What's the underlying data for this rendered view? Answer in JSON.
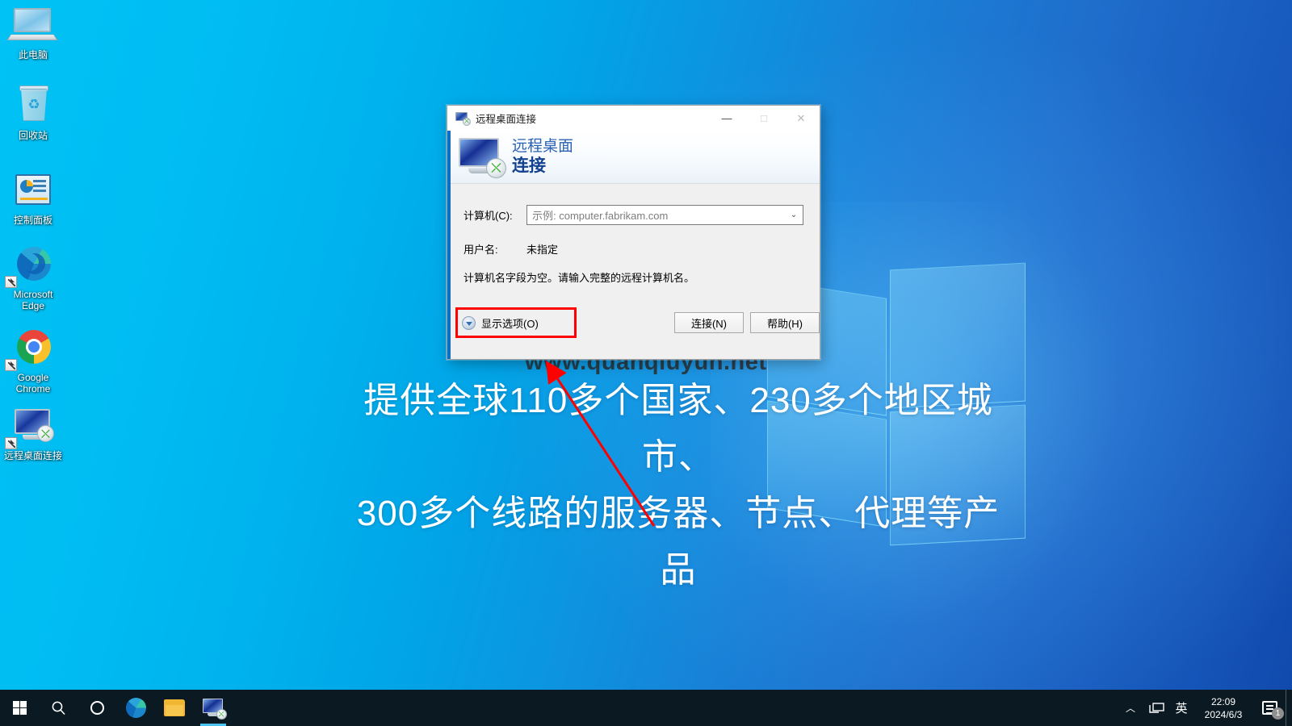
{
  "desktop": {
    "icons": [
      {
        "name": "this-pc",
        "label": "此电脑",
        "icon": "monitor-icon",
        "shortcut": false
      },
      {
        "name": "recycle-bin",
        "label": "回收站",
        "icon": "recycle-bin-icon",
        "shortcut": false
      },
      {
        "name": "control-panel",
        "label": "控制面板",
        "icon": "control-panel-icon",
        "shortcut": false
      },
      {
        "name": "microsoft-edge",
        "label": "Microsoft\nEdge",
        "icon": "edge-icon",
        "shortcut": true
      },
      {
        "name": "google-chrome",
        "label": "Google\nChrome",
        "icon": "chrome-icon",
        "shortcut": true
      },
      {
        "name": "remote-desktop-connection",
        "label": "远程桌面连接",
        "icon": "rdp-icon",
        "shortcut": true
      }
    ],
    "watermark_url": "www.quanqiuyun.net",
    "promo_line1": "提供全球110多个国家、230多个地区城市、",
    "promo_line2": "300多个线路的服务器、节点、代理等产品"
  },
  "dialog": {
    "titlebar": {
      "title": "远程桌面连接",
      "minimize": "—",
      "maximize": "□",
      "close": "✕"
    },
    "header": {
      "line1": "远程桌面",
      "line2": "连接"
    },
    "form": {
      "computer_label": "计算机(C):",
      "computer_placeholder": "示例: computer.fabrikam.com",
      "computer_value": "",
      "username_label": "用户名:",
      "username_value": "未指定",
      "hint_message": "计算机名字段为空。请输入完整的远程计算机名。"
    },
    "footer": {
      "show_options_label": "显示选项(O)",
      "connect_label": "连接(N)",
      "help_label": "帮助(H)"
    }
  },
  "annotation": {
    "highlight_color": "#ff0000",
    "arrow_color": "#ff0000",
    "target": "显示选项(O)"
  },
  "taskbar": {
    "start": "start-icon",
    "search": "search-icon",
    "cortana": "cortana-icon",
    "pinned": [
      {
        "name": "taskbar-edge",
        "icon": "edge-icon",
        "active": false
      },
      {
        "name": "taskbar-explorer",
        "icon": "folder-icon",
        "active": false
      },
      {
        "name": "taskbar-rdp",
        "icon": "rdp-icon",
        "active": true
      }
    ],
    "tray": {
      "chevron": "︿",
      "network_icon": "network-icon",
      "ime": "英",
      "time": "22:09",
      "date": "2024/6/3",
      "action_center_icon": "action-center-icon",
      "notification_count": "1"
    }
  }
}
